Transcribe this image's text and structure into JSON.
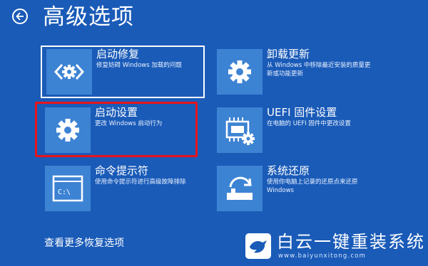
{
  "header": {
    "title": "高级选项"
  },
  "tiles": [
    {
      "title": "启动修复",
      "desc": "修复妨碍 Windows 加载的问题",
      "icon": "startup-repair-icon"
    },
    {
      "title": "卸载更新",
      "desc": "从 Windows 中移除最近安装的质量更新或功能更新",
      "icon": "gear-icon"
    },
    {
      "title": "启动设置",
      "desc": "更改 Windows 启动行为",
      "icon": "gear-icon"
    },
    {
      "title": "UEFI 固件设置",
      "desc": "在电脑的 UEFI 固件中更改设置",
      "icon": "firmware-chip-icon"
    },
    {
      "title": "命令提示符",
      "desc": "使用命令提示符进行高级故障排除",
      "icon": "command-prompt-icon"
    },
    {
      "title": "系统还原",
      "desc": "使用你电脑上记录的还原点来还原 Windows",
      "icon": "system-restore-icon"
    }
  ],
  "cmd_glyph": "C:\\",
  "footer": {
    "more_options": "查看更多恢复选项"
  },
  "watermark": {
    "title": "白云一键重装系统",
    "url": "www.baiyunxitong.com"
  },
  "colors": {
    "background": "#1a5bb8",
    "icon_tile": "#3d83d3",
    "highlight": "#e8141b"
  }
}
